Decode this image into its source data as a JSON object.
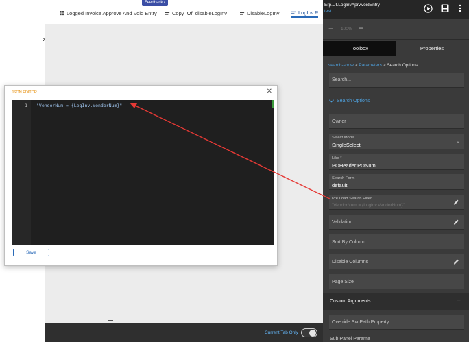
{
  "tabs": {
    "feedback": "Feedback",
    "items": [
      {
        "label": "Logged Invoice Approve And Void Entry"
      },
      {
        "label": "Copy_Of_disableLogInv"
      },
      {
        "label": "DisableLogInv"
      },
      {
        "label": "LogInv.R"
      }
    ]
  },
  "bottom": {
    "toggle_label": "Current Tab Only",
    "toggle_on": true
  },
  "panel": {
    "app_name": "Erp.UI.LogInvAprvVoidEntry",
    "layer": "test",
    "zoom": "100%",
    "tab_toolbox": "Toolbox",
    "tab_properties": "Properties",
    "breadcrumb": {
      "a": "search-show",
      "sep1": ">",
      "b": "Parameters",
      "sep2": ">",
      "c": "Search Options"
    },
    "search_placeholder": "Search...",
    "section_title": "Search Options",
    "owner_placeholder": "Owner",
    "select_mode_label": "Select Mode",
    "select_mode_value": "SingleSelect",
    "like_label": "Like *",
    "like_value": "POHeader.PONum",
    "search_form_label": "Search Form",
    "search_form_value": "default",
    "preload_label": "Pre Load Search Filter",
    "preload_value": "\"VendorNum = {LogInv.VendorNum}\"",
    "validation_placeholder": "Validation",
    "sort_placeholder": "Sort By Column",
    "disable_cols_placeholder": "Disable Columns",
    "page_size_placeholder": "Page Size",
    "custom_args": "Custom Arguments",
    "custom_args_toggle": "−",
    "override_placeholder": "Override SvcPath Property",
    "sub_panel": "Sub Panel Parame"
  },
  "modal": {
    "title": "JSON EDITOR",
    "close": "✕",
    "line_number": "1",
    "code": "\"VendorNum = {LogInv.VendorNum}\"",
    "save_label": "Save"
  },
  "colors": {
    "accent": "#4fa3e0",
    "arrow": "#e53935",
    "panel_bg": "#3a3a3a"
  }
}
